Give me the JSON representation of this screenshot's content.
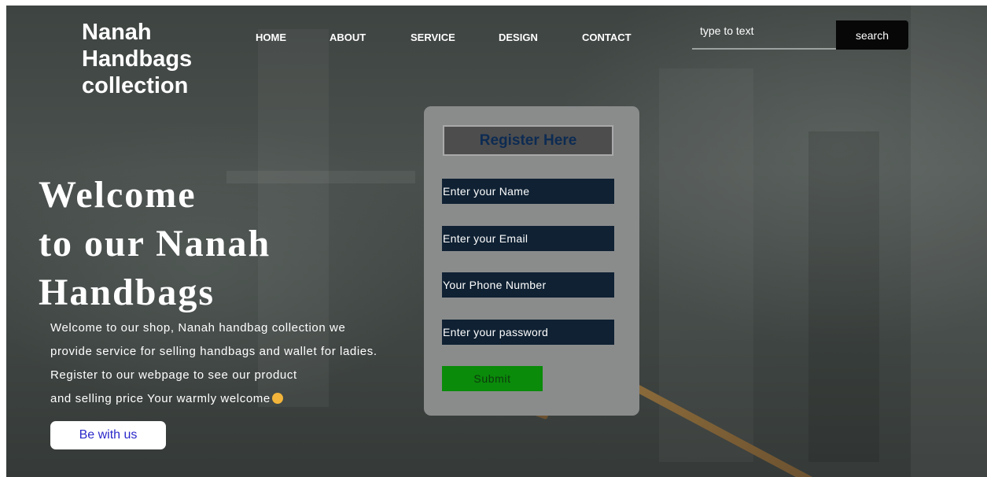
{
  "brand": {
    "line1": "Nanah",
    "line2": "Handbags",
    "line3": "collection"
  },
  "nav": {
    "items": [
      "HOME",
      "ABOUT",
      "SERVICE",
      "DESIGN",
      "CONTACT"
    ]
  },
  "search": {
    "placeholder": "type to text",
    "button_label": "search"
  },
  "hero": {
    "title_line1": "Welcome",
    "title_line2": "to our Nanah",
    "title_line3": "Handbags",
    "text_line1": "Welcome to our shop, Nanah handbag collection we",
    "text_line2": "provide service for selling handbags and wallet for ladies.",
    "text_line3": "Register to our webpage to see our product",
    "text_line4": "and selling price Your warmly welcome",
    "emoji_icon": "smiling-face-icon",
    "cta_label": "Be with us"
  },
  "register_form": {
    "title": "Register Here",
    "fields": [
      {
        "placeholder": "Enter your Name"
      },
      {
        "placeholder": "Enter your Email"
      },
      {
        "placeholder": "Your Phone Number"
      },
      {
        "placeholder": "Enter your password"
      }
    ],
    "submit_label": "Submit"
  },
  "colors": {
    "field_bg": "#0f2133",
    "submit_bg": "#0a8b0a",
    "title_text": "#0d2b52",
    "cta_text": "#2a28c9"
  }
}
